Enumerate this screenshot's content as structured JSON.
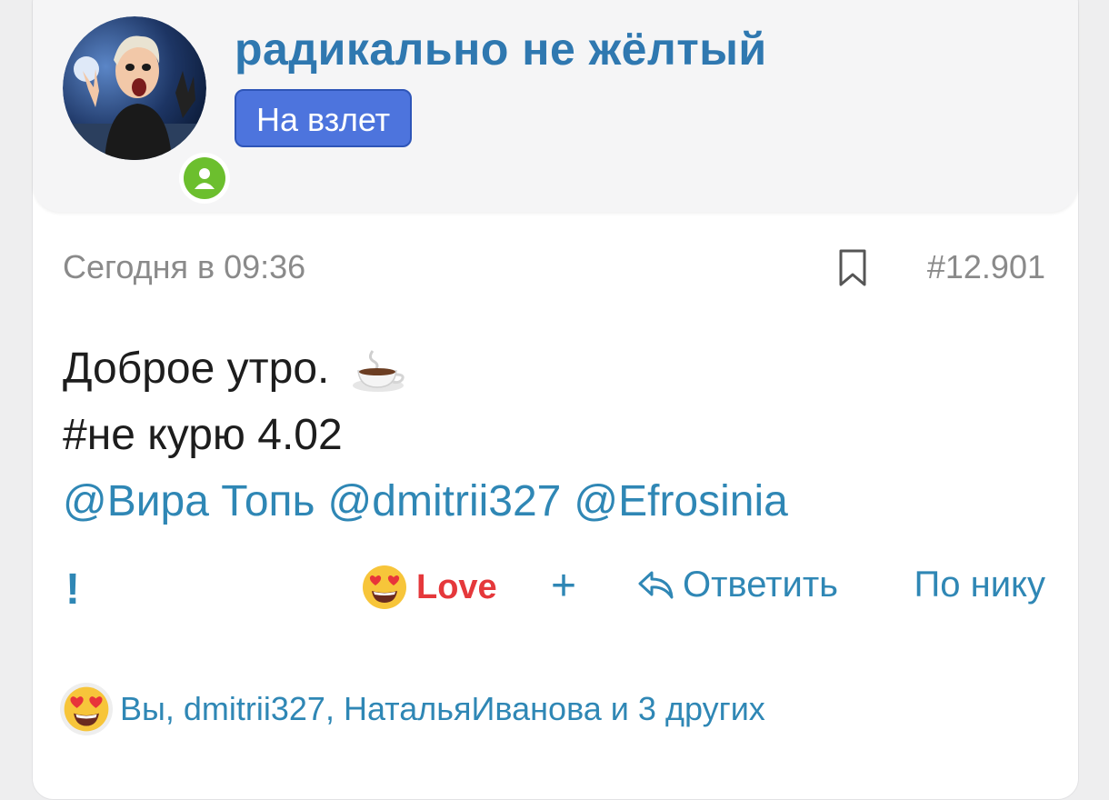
{
  "profile": {
    "username": "радикально не жёлтый",
    "badge": "На взлет",
    "status_color": "#6cbf2e"
  },
  "post": {
    "time": "Сегодня в 09:36",
    "number": "#12.901",
    "line1": "Доброе утро.",
    "line2": "#не курю 4.02",
    "mentions": [
      "@Вира Топь",
      "@dmitrii327",
      "@Efrosinia"
    ]
  },
  "actions": {
    "report": "!",
    "love": "Love",
    "add_reaction": "+",
    "reply": "Ответить",
    "by_nick": "По нику"
  },
  "reactions_summary": "Вы, dmitrii327, НатальяИванова и 3 других",
  "icons": [
    "user-icon",
    "bookmark-icon",
    "coffee-cup-icon",
    "heart-eyes-emoji-icon",
    "reply-arrow-icon"
  ],
  "colors": {
    "accent": "#2f87b5",
    "badge": "#4d74dd",
    "love": "#e5383b"
  }
}
